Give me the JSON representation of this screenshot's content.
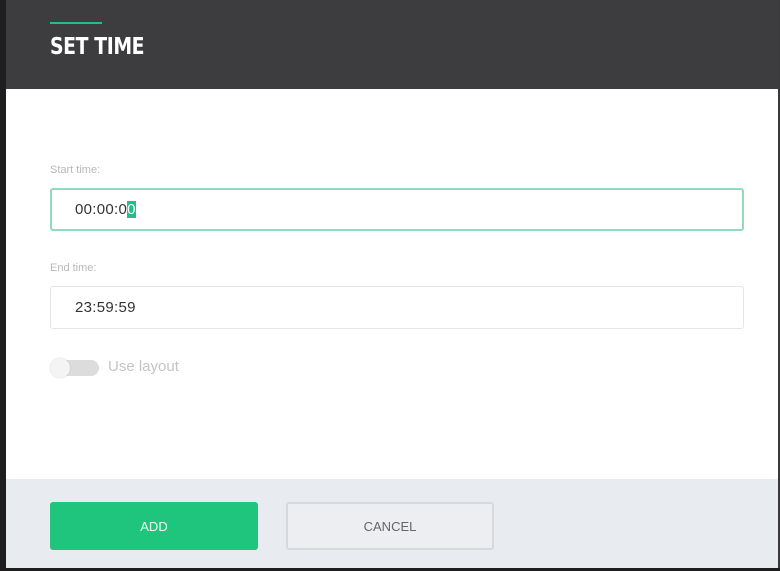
{
  "dialog": {
    "title": "SET TIME",
    "accent_color": "#1fbf87",
    "header_color": "#3d3d3f"
  },
  "form": {
    "start_time": {
      "label": "Start time:",
      "value_main": "00:00:0",
      "value_selected": "0"
    },
    "end_time": {
      "label": "End time:",
      "value": "23:59:59"
    },
    "use_layout": {
      "label": "Use layout",
      "enabled": false
    }
  },
  "footer": {
    "add_label": "ADD",
    "cancel_label": "CANCEL",
    "add_color": "#1fc57c"
  }
}
